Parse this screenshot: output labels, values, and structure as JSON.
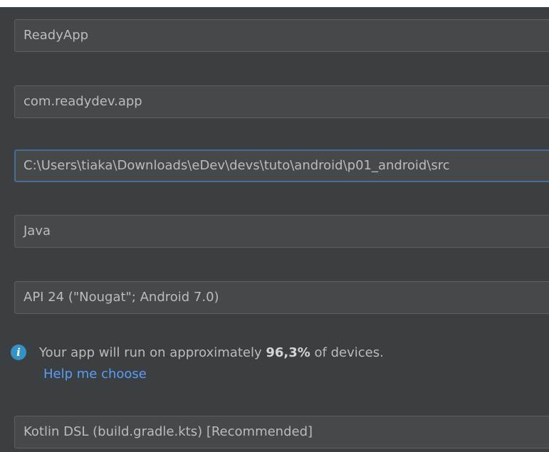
{
  "form": {
    "name_value": "ReadyApp",
    "package_value": "com.readydev.app",
    "save_location_value": "C:\\Users\\tiaka\\Downloads\\eDev\\devs\\tuto\\android\\p01_android\\src",
    "language_value": "Java",
    "minimum_sdk_value": "API 24 (\"Nougat\"; Android 7.0)",
    "build_config_value": "Kotlin DSL (build.gradle.kts) [Recommended]"
  },
  "info": {
    "icon": "info-icon",
    "icon_glyph": "i",
    "text_prefix": "Your app will run on approximately ",
    "percentage": "96,3%",
    "text_suffix": " of devices.",
    "help_link_label": "Help me choose"
  },
  "colors": {
    "background": "#3c3f41",
    "field_background": "#45494a",
    "field_border": "#5e6060",
    "focus_border": "#466d94",
    "text": "#bbbbbb",
    "link": "#589df6",
    "info_icon": "#3592c4"
  }
}
